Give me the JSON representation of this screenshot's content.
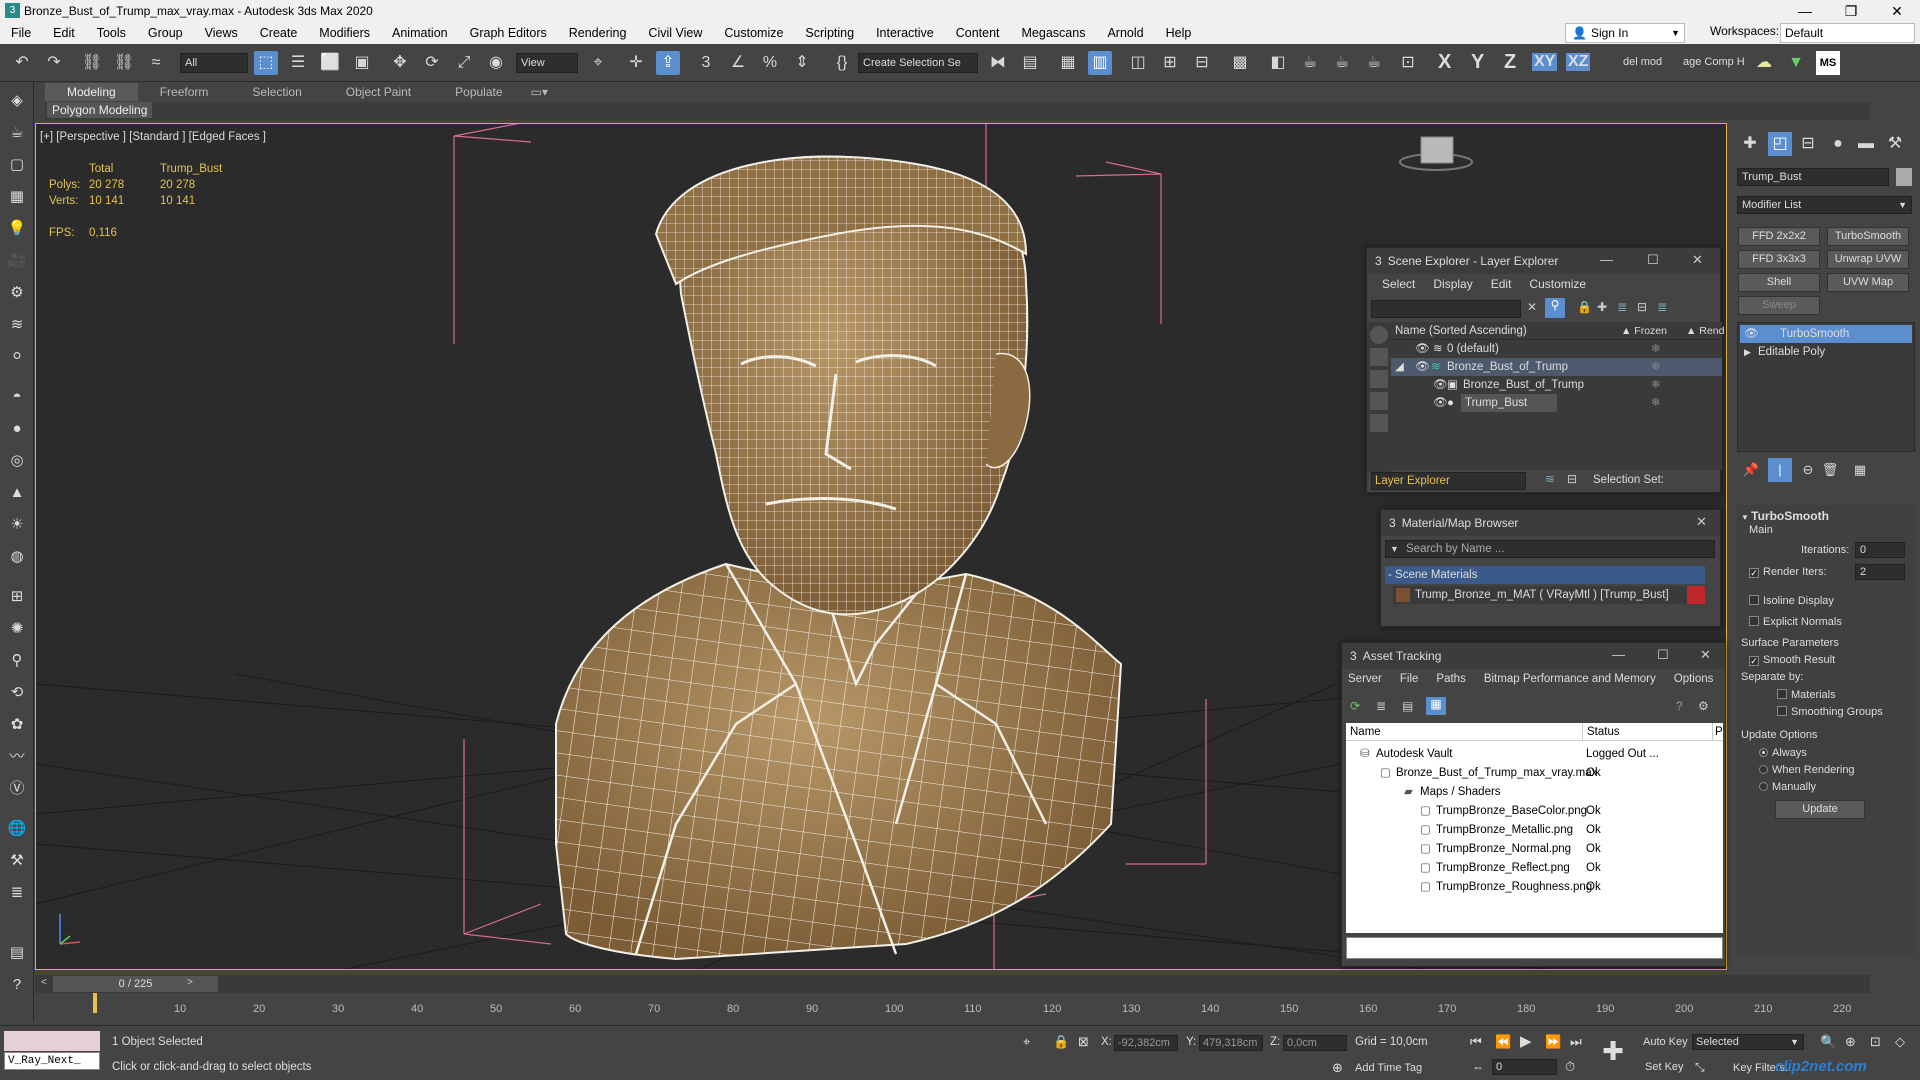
{
  "window": {
    "title": "Bronze_Bust_of_Trump_max_vray.max - Autodesk 3ds Max 2020"
  },
  "menu": [
    "File",
    "Edit",
    "Tools",
    "Group",
    "Views",
    "Create",
    "Modifiers",
    "Animation",
    "Graph Editors",
    "Rendering",
    "Civil View",
    "Customize",
    "Scripting",
    "Interactive",
    "Content",
    "Megascans",
    "Arnold",
    "Help"
  ],
  "account": {
    "sign_in": "Sign In",
    "workspaces_label": "Workspaces:",
    "workspace": "Default"
  },
  "toolbar": {
    "filter": "All",
    "ref_coord": "View",
    "selection_set": "Create Selection Se",
    "axes": [
      "X",
      "Y",
      "Z",
      "XY",
      "XZ"
    ],
    "del_mod": "del mod",
    "comp_help": "age Comp Help",
    "ms": "MS"
  },
  "ribbon": {
    "tabs": [
      "Modeling",
      "Freeform",
      "Selection",
      "Object Paint",
      "Populate"
    ],
    "sub": "Polygon Modeling"
  },
  "viewport": {
    "label": "[+] [Perspective ] [Standard ] [Edged Faces ]",
    "stats": {
      "col_total": "Total",
      "col_obj": "Trump_Bust",
      "polys_label": "Polys:",
      "polys_total": "20 278",
      "polys_obj": "20 278",
      "verts_label": "Verts:",
      "verts_total": "10 141",
      "verts_obj": "10 141",
      "fps_label": "FPS:",
      "fps": "0,116"
    }
  },
  "scene_explorer": {
    "title": "Scene Explorer - Layer Explorer",
    "menu": [
      "Select",
      "Display",
      "Edit",
      "Customize"
    ],
    "columns": {
      "name": "Name (Sorted Ascending)",
      "frozen": "▲ Frozen",
      "render": "▲ Rend"
    },
    "rows": [
      "0 (default)",
      "Bronze_Bust_of_Trump",
      "Bronze_Bust_of_Trump",
      "Trump_Bust"
    ],
    "footer_dropdown": "Layer Explorer",
    "selection_set_label": "Selection Set:"
  },
  "material_browser": {
    "title": "Material/Map Browser",
    "search_placeholder": "Search by Name ...",
    "group": "- Scene Materials",
    "item": "Trump_Bronze_m_MAT ( VRayMtl ) [Trump_Bust]"
  },
  "asset_tracking": {
    "title": "Asset Tracking",
    "menu": [
      "Server",
      "File",
      "Paths",
      "Bitmap Performance and Memory",
      "Options"
    ],
    "columns": {
      "name": "Name",
      "status": "Status",
      "extra": "P"
    },
    "rows": [
      {
        "name": "Autodesk Vault",
        "status": "Logged Out ..."
      },
      {
        "name": "Bronze_Bust_of_Trump_max_vray.max",
        "status": "Ok"
      },
      {
        "name": "Maps / Shaders",
        "status": ""
      },
      {
        "name": "TrumpBronze_BaseColor.png",
        "status": "Ok"
      },
      {
        "name": "TrumpBronze_Metallic.png",
        "status": "Ok"
      },
      {
        "name": "TrumpBronze_Normal.png",
        "status": "Ok"
      },
      {
        "name": "TrumpBronze_Reflect.png",
        "status": "Ok"
      },
      {
        "name": "TrumpBronze_Roughness.png",
        "status": "Ok"
      }
    ]
  },
  "modify_panel": {
    "object_name": "Trump_Bust",
    "modifier_list": "Modifier List",
    "buttons": [
      "FFD 2x2x2",
      "TurboSmooth",
      "FFD 3x3x3",
      "Unwrap UVW",
      "Shell",
      "UVW Map",
      "Sweep"
    ],
    "stack": [
      "TurboSmooth",
      "Editable Poly"
    ],
    "rollout_title": "TurboSmooth",
    "main_label": "Main",
    "iterations_label": "Iterations:",
    "iterations": "0",
    "render_iters_label": "Render Iters:",
    "render_iters": "2",
    "isoline": "Isoline Display",
    "explicit_normals": "Explicit Normals",
    "surface_params": "Surface Parameters",
    "smooth_result": "Smooth Result",
    "separate_by": "Separate by:",
    "materials": "Materials",
    "smoothing_groups": "Smoothing Groups",
    "update_options": "Update Options",
    "always": "Always",
    "when_rendering": "When Rendering",
    "manually": "Manually",
    "update_btn": "Update"
  },
  "timeline": {
    "frame": "0 / 225",
    "ticks": [
      "10",
      "20",
      "30",
      "40",
      "50",
      "60",
      "70",
      "80",
      "90",
      "100",
      "110",
      "120",
      "130",
      "140",
      "150",
      "160",
      "170",
      "180",
      "190",
      "200",
      "210",
      "220"
    ]
  },
  "status": {
    "maxscript": "V_Ray_Next_",
    "selected": "1 Object Selected",
    "prompt": "Click or click-and-drag to select objects",
    "x_label": "X:",
    "x": "-92,382cm",
    "y_label": "Y:",
    "y": "479,318cm",
    "z_label": "Z:",
    "z": "0,0cm",
    "grid": "Grid = 10,0cm",
    "add_time_tag": "Add Time Tag",
    "auto_key": "Auto Key",
    "selected_dd": "Selected",
    "set_key": "Set Key",
    "key_filters": "Key Filters...",
    "frame_field": "0",
    "watermark": "clip2net.com"
  }
}
